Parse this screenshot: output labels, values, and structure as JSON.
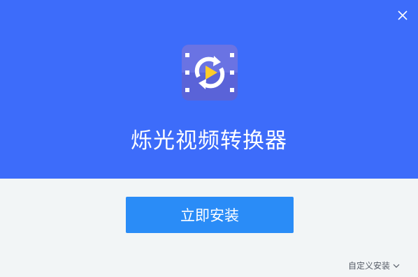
{
  "header": {
    "app_title": "烁光视频转换器",
    "background_color": "#3d6cfa",
    "close_icon": "close-icon",
    "app_icon": "video-convert-play-icon"
  },
  "main": {
    "install_button_label": "立即安装",
    "install_button_color": "#2a8cf7",
    "custom_install_label": "自定义安装",
    "custom_install_icon": "chevron-down-icon"
  }
}
